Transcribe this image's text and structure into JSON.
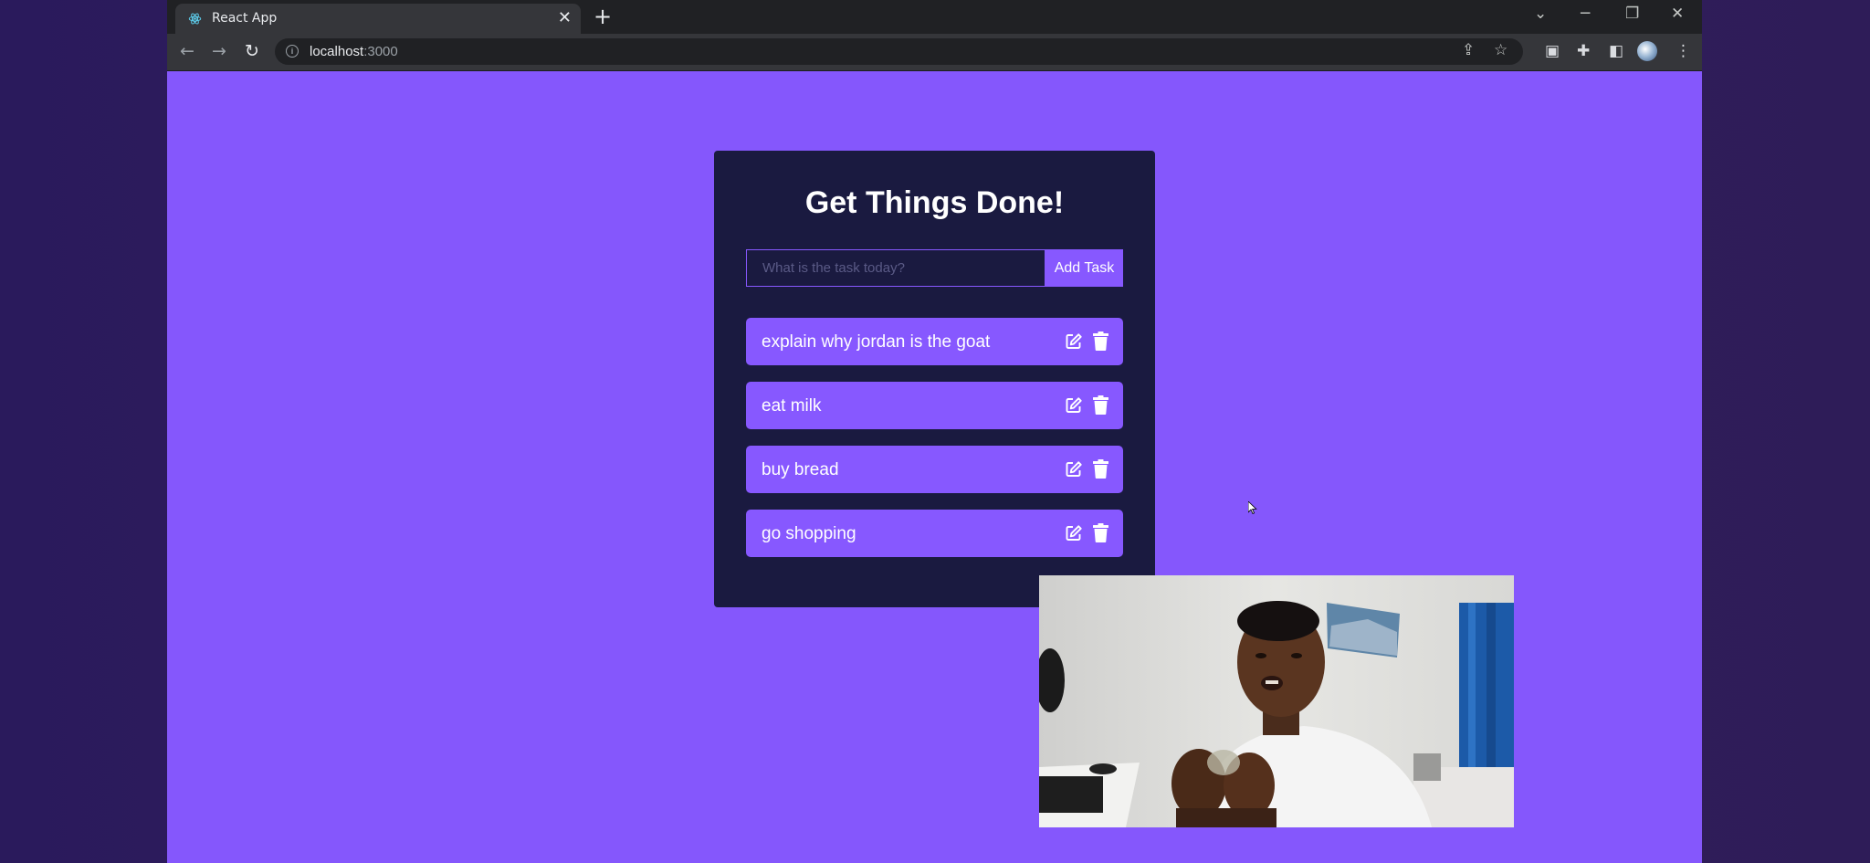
{
  "browser": {
    "tab_title": "React App",
    "tab_close": "✕",
    "new_tab": "+",
    "url_host": "localhost",
    "url_port": ":3000"
  },
  "app": {
    "title": "Get Things Done!",
    "input_placeholder": "What is the task today?",
    "input_value": "",
    "add_button": "Add Task",
    "todos": [
      {
        "text": "explain why jordan is the goat"
      },
      {
        "text": "eat milk"
      },
      {
        "text": "buy bread"
      },
      {
        "text": "go shopping"
      }
    ]
  },
  "colors": {
    "page_bg": "#8557fc",
    "card_bg": "#1a1a40",
    "accent": "#8758ff",
    "text": "#ffffff"
  },
  "icons": {
    "tab_favicon": "react-icon",
    "edit": "edit-icon",
    "delete": "trash-icon"
  }
}
